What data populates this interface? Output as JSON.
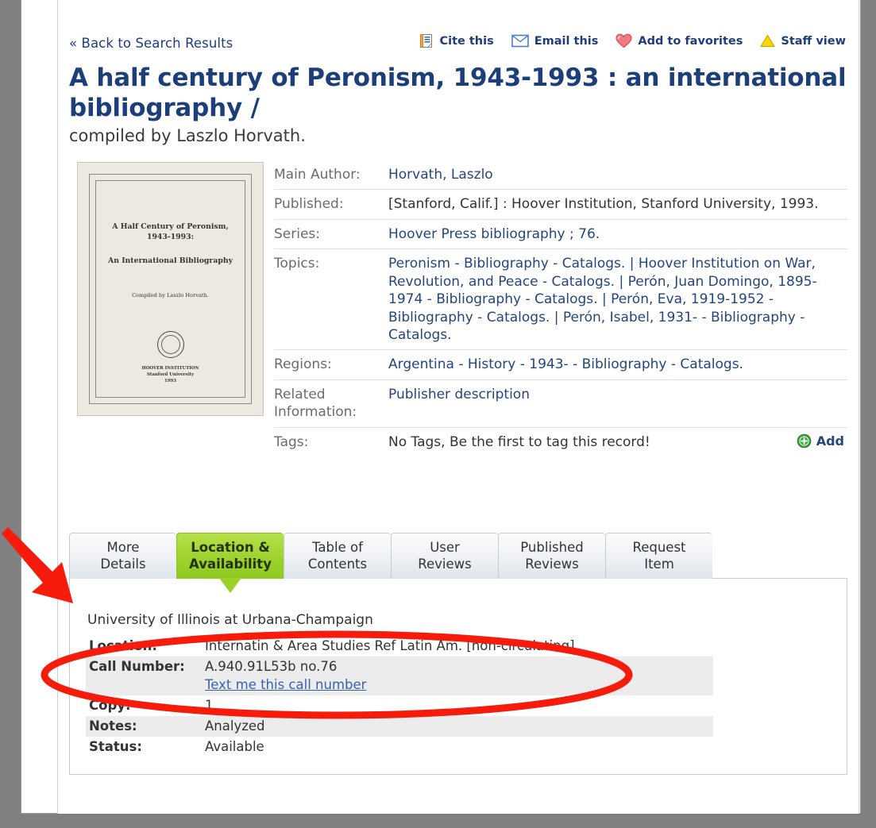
{
  "topbar": {
    "back_label": "« Back to Search Results",
    "tools": [
      {
        "label": "Cite this",
        "icon": "cite-icon"
      },
      {
        "label": "Email this",
        "icon": "email-icon"
      },
      {
        "label": "Add to favorites",
        "icon": "heart-icon"
      },
      {
        "label": "Staff view",
        "icon": "warning-triangle-icon"
      }
    ]
  },
  "record": {
    "title": "A half century of Peronism, 1943-1993 : an international bibliography /",
    "subtitle": "compiled by Laszlo Horvath.",
    "cover": {
      "line1": "A Half Century of Peronism,",
      "line2": "1943-1993:",
      "line3": "An International Bibliography",
      "line4": "Compiled by Laszlo Horvath.",
      "publisher_line1": "HOOVER INSTITUTION",
      "publisher_line2": "Stanford University",
      "publisher_line3": "1993"
    },
    "fields": [
      {
        "label": "Main Author:",
        "value": "Horvath, Laszlo",
        "link": true
      },
      {
        "label": "Published:",
        "value": "[Stanford, Calif.] : Hoover Institution, Stanford University, 1993.",
        "link": false
      },
      {
        "label": "Series:",
        "value": "Hoover Press bibliography ; 76.",
        "link": true
      },
      {
        "label": "Topics:",
        "value": "Peronism - Bibliography - Catalogs. | Hoover Institution on War, Revolution, and Peace - Catalogs. | Perón, Juan Domingo, 1895-1974 - Bibliography - Catalogs. | Perón, Eva, 1919-1952 - Bibliography - Catalogs. | Perón, Isabel, 1931- - Bibliography - Catalogs.",
        "link": true
      },
      {
        "label": "Regions:",
        "value": "Argentina - History - 1943- - Bibliography - Catalogs.",
        "link": true
      },
      {
        "label": "Related Information:",
        "value": "Publisher description",
        "link": true
      }
    ],
    "tags": {
      "label": "Tags:",
      "value": "No Tags, Be the first to tag this record!",
      "add_label": "Add",
      "add_icon": "add-circle-icon"
    }
  },
  "tabs": [
    {
      "label_line1": "More",
      "label_line2": "Details",
      "active": false
    },
    {
      "label_line1": "Location &",
      "label_line2": "Availability",
      "active": true
    },
    {
      "label_line1": "Table of",
      "label_line2": "Contents",
      "active": false
    },
    {
      "label_line1": "User",
      "label_line2": "Reviews",
      "active": false
    },
    {
      "label_line1": "Published",
      "label_line2": "Reviews",
      "active": false
    },
    {
      "label_line1": "Request",
      "label_line2": "Item",
      "active": false
    }
  ],
  "holdings": {
    "library": "University of Illinois at Urbana-Champaign",
    "rows": [
      {
        "label": "Location:",
        "value": "Internatin & Area Studies Ref Latin Am. [non-circulating]",
        "striped": false
      },
      {
        "label": "Call Number:",
        "value": "A.940.91L53b no.76",
        "sublink": "Text me this call number",
        "striped": true
      },
      {
        "label": "Copy:",
        "value": "1",
        "striped": false
      },
      {
        "label": "Notes:",
        "value": "Analyzed",
        "striped": true
      },
      {
        "label": "Status:",
        "value": "Available",
        "striped": false
      }
    ]
  },
  "annotations": {
    "arrow": {
      "name": "red-arrow-annotation",
      "color": "#f61b0b"
    },
    "ellipse": {
      "name": "red-ellipse-annotation",
      "color": "#f61b0b"
    }
  },
  "colors": {
    "title_blue": "#1d3f79",
    "link_blue": "#24467e",
    "active_tab_green": "#9ed22e",
    "annotation_red": "#f61b0b",
    "page_background": "#808080"
  }
}
